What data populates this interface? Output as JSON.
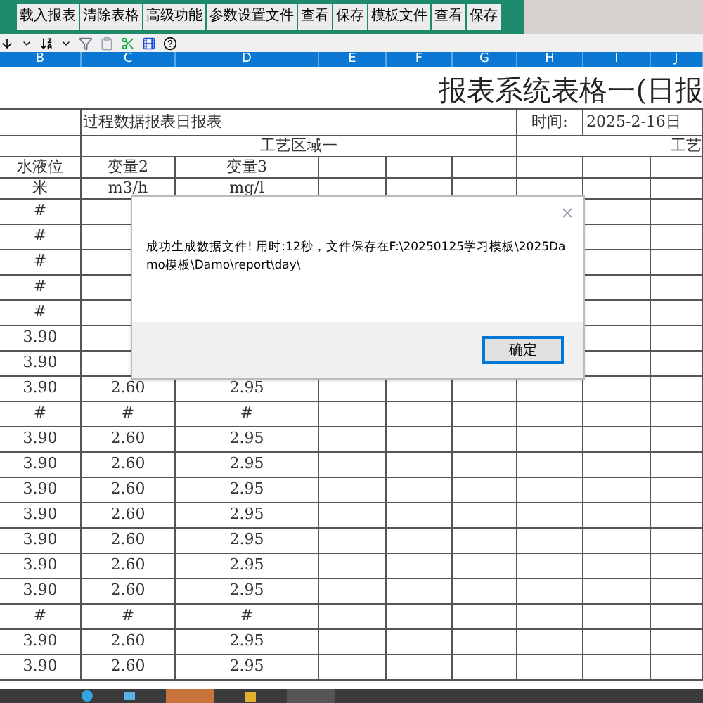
{
  "toolbar": {
    "buttons": [
      {
        "label": "载入报表"
      },
      {
        "label": "清除表格"
      },
      {
        "label": "高级功能"
      },
      {
        "label": "参数设置文件"
      },
      {
        "label": "查看"
      },
      {
        "label": "保存"
      },
      {
        "label": "模板文件"
      },
      {
        "label": "查看"
      },
      {
        "label": "保存"
      }
    ]
  },
  "column_headers": [
    "B",
    "C",
    "D",
    "E",
    "F",
    "G",
    "H",
    "I",
    "J"
  ],
  "report": {
    "title": "报表系统表格一(日报",
    "name": "过程数据报表日报表",
    "time_label": "时间:",
    "date": "2025-2-16日",
    "area": "工艺区域一",
    "area_2": "工艺",
    "variables": [
      "水液位",
      "变量2",
      "变量3"
    ],
    "units": [
      "米",
      "m3/h",
      "mg/l"
    ]
  },
  "rows": [
    [
      "#"
    ],
    [
      "#"
    ],
    [
      "#"
    ],
    [
      "#"
    ],
    [
      "#"
    ],
    [
      "3.90"
    ],
    [
      "3.90"
    ],
    [
      "3.90",
      "2.60",
      "2.95"
    ],
    [
      "#",
      "#",
      "#"
    ],
    [
      "3.90",
      "2.60",
      "2.95"
    ],
    [
      "3.90",
      "2.60",
      "2.95"
    ],
    [
      "3.90",
      "2.60",
      "2.95"
    ],
    [
      "3.90",
      "2.60",
      "2.95"
    ],
    [
      "3.90",
      "2.60",
      "2.95"
    ],
    [
      "3.90",
      "2.60",
      "2.95"
    ],
    [
      "3.90",
      "2.60",
      "2.95"
    ],
    [
      "#",
      "#",
      "#"
    ],
    [
      "3.90",
      "2.60",
      "2.95"
    ],
    [
      "3.90",
      "2.60",
      "2.95"
    ]
  ],
  "dialog": {
    "message": "成功生成数据文件! 用时:12秒，文件保存在F:\\20250125学习模板\\2025Damo模板\\Damo\\report\\day\\",
    "ok_button": "确定"
  }
}
